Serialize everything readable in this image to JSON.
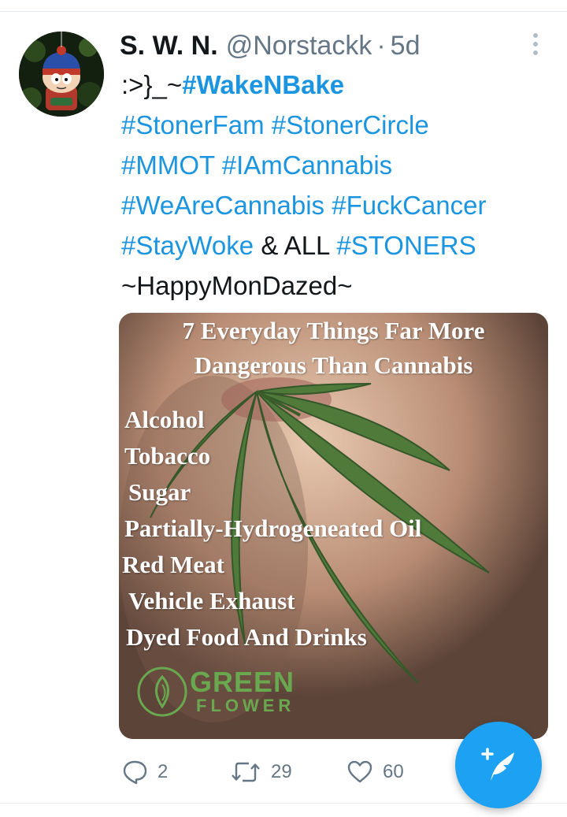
{
  "tweet": {
    "display_name": "S. W. N.",
    "handle": "@Norstackk",
    "separator": "·",
    "time_ago": "5d",
    "lines": [
      [
        {
          "text": ":>}_~",
          "kind": "plain"
        },
        {
          "text": "#WakeNBake",
          "kind": "tag-bold"
        }
      ],
      [
        {
          "text": "#StonerFam",
          "kind": "tag"
        },
        {
          "text": " ",
          "kind": "plain"
        },
        {
          "text": "#StonerCircle",
          "kind": "tag"
        }
      ],
      [
        {
          "text": "#MMOT",
          "kind": "tag"
        },
        {
          "text": " ",
          "kind": "plain"
        },
        {
          "text": "#IAmCannabis",
          "kind": "tag"
        }
      ],
      [
        {
          "text": "#WeAreCannabis",
          "kind": "tag"
        },
        {
          "text": " ",
          "kind": "plain"
        },
        {
          "text": "#FuckCancer",
          "kind": "tag"
        }
      ],
      [
        {
          "text": "#StayWoke",
          "kind": "tag"
        },
        {
          "text": " & ALL ",
          "kind": "plain"
        },
        {
          "text": "#STONERS",
          "kind": "tag"
        }
      ],
      [
        {
          "text": "~HappyMonDazed~",
          "kind": "plain"
        }
      ]
    ]
  },
  "media": {
    "title_line1": "7 Everyday Things Far More",
    "title_line2": "Dangerous Than Cannabis",
    "items": [
      "Alcohol",
      "Tobacco",
      "Sugar",
      "Partially-Hydrogeneated Oil",
      "Red Meat",
      "Vehicle Exhaust",
      "Dyed Food And Drinks"
    ],
    "logo_word1": "GREEN",
    "logo_word2": "FLOWER"
  },
  "actions": {
    "reply_count": "2",
    "retweet_count": "29",
    "like_count": "60"
  },
  "colors": {
    "accent": "#1da1f2",
    "hashtag": "#1b95e0",
    "secondary_text": "#657786",
    "logo_green": "#6aa84f"
  },
  "icons": [
    "more-vertical-icon",
    "reply-icon",
    "retweet-icon",
    "like-icon",
    "compose-tweet-icon"
  ]
}
